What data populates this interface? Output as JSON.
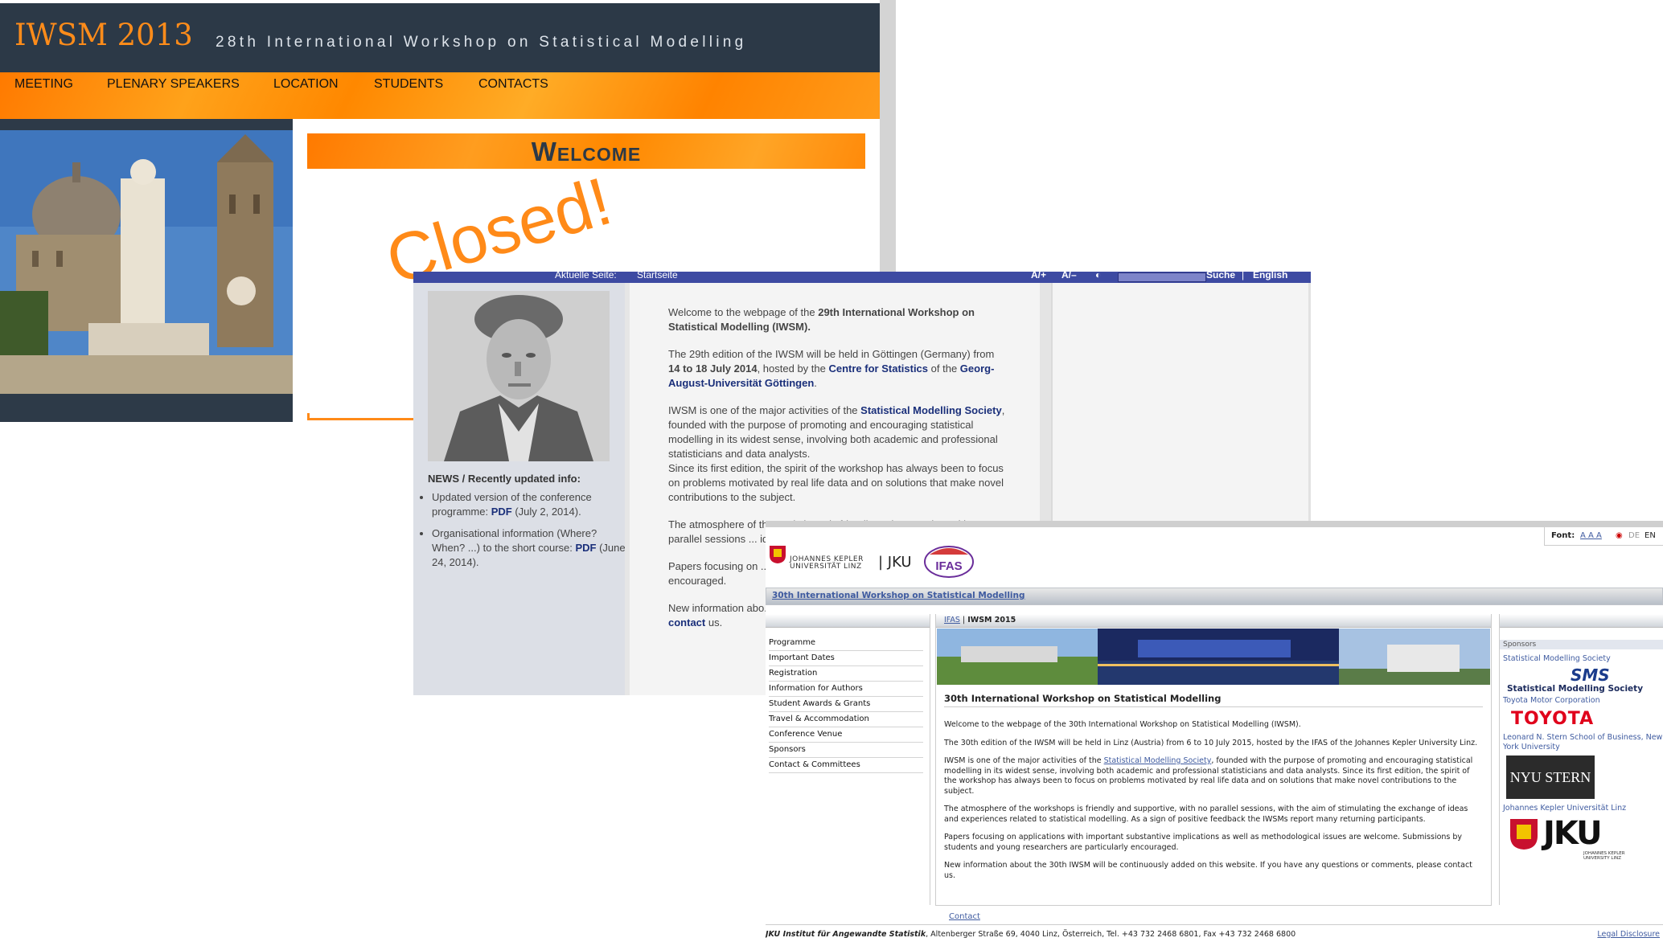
{
  "w1": {
    "logo": "IWSM 2013",
    "tagline": "28th International Workshop on Statistical Modelling",
    "nav": [
      "MEETING",
      "PLENARY SPEAKERS",
      "LOCATION",
      "STUDENTS",
      "CONTACTS"
    ],
    "welcome": "Welcome",
    "stamp": "Closed!",
    "colors": {
      "header": "#2c3947",
      "accent": "#ff8a18"
    }
  },
  "w2": {
    "topbar": {
      "breadcrumb_label": "Aktuelle Seite:",
      "breadcrumb_page": "Startseite",
      "font_plus": "A/+",
      "font_minus": "A/–",
      "search": "Suche",
      "lang": "English"
    },
    "news_title": "NEWS / Recently updated info:",
    "news": [
      {
        "pre": "Updated version of the conference programme: ",
        "link": "PDF",
        "post": " (July 2, 2014)."
      },
      {
        "pre": "Organisational information (Where? When? ...) to the short course: ",
        "link": "PDF",
        "post": " (June 24, 2014)."
      }
    ],
    "p1_pre": "Welcome to the webpage of the ",
    "p1_bold": "29th International Workshop on Statistical Modelling (IWSM).",
    "p2_a": "The 29th edition of the IWSM will be held in Göttingen (Germany) from ",
    "p2_bold": "14 to 18 July 2014",
    "p2_b": ", hosted by the ",
    "p2_link1": "Centre for Statistics",
    "p2_c": " of the ",
    "p2_link2": "Georg-August-Universität Göttingen",
    "p2_d": ".",
    "p3_a": "IWSM is one of the major activities of the ",
    "p3_link": "Statistical Modelling Society",
    "p3_b": ", founded with the purpose of promoting and encouraging statistical modelling in its widest sense, involving both academic and professional statisticians and data analysts.",
    "p3_c": "Since its first edition, the spirit of the workshop has always been to focus on problems motivated by real life data and on solutions that make novel contributions to the subject.",
    "p4": "The atmosphere of the workshops is friendly and supportive, with no parallel sessions ... ideas and experienc... positive feedback th...",
    "p5": "Papers focusing on ... implications as well ... Submissions by stu... encouraged.",
    "p6_a": "New information abo... on this website. If yo...",
    "p6_link": "contact",
    "p6_b": " us."
  },
  "w3": {
    "font_label": "Font:",
    "font_sizes": "A A A",
    "langs": [
      "DE",
      "EN"
    ],
    "jku_line1": "JOHANNES KEPLER",
    "jku_line2": "UNIVERSITÄT LINZ",
    "jku_short": "JKU",
    "ifas": "IFAS",
    "title_bar": "30th International Workshop on Statistical Modelling",
    "menu": [
      "Programme",
      "Important Dates",
      "Registration",
      "Information for Authors",
      "Student Awards & Grants",
      "Travel & Accommodation",
      "Conference Venue",
      "Sponsors",
      "Contact & Committees"
    ],
    "breadcrumb_link": "IFAS",
    "breadcrumb_sep": " | ",
    "breadcrumb_current": "IWSM 2015",
    "content_title": "30th International Workshop on Statistical Modelling",
    "paragraphs": [
      "Welcome to the webpage of the 30th International Workshop on Statistical Modelling (IWSM).",
      "The 30th edition of the IWSM will be held in Linz (Austria) from 6 to 10 July 2015, hosted by the IFAS of the Johannes Kepler University Linz.",
      "",
      "The atmosphere of the workshops is friendly and supportive, with no parallel sessions, with the aim of stimulating the exchange of ideas and experiences related to statistical modelling. As a sign of positive feedback the IWSMs report many returning participants.",
      "Papers focusing on applications with important substantive implications as well as methodological issues are welcome. Submissions by students and young researchers are particularly encouraged.",
      "New information about the 30th IWSM will be continuously added on this website. If you have any questions or comments, please contact us."
    ],
    "p3_a": "IWSM is one of the major activities of the ",
    "p3_link": "Statistical Modelling Society",
    "p3_b": ", founded with the purpose of promoting and encouraging statistical modelling in its widest sense, involving both academic and professional statisticians and data analysts. Since its first edition, the spirit of the workshop has always been to focus on problems motivated by real life data and on solutions that make novel contributions to the subject.",
    "sponsors_header": "Sponsors",
    "sponsors": [
      "Statistical Modelling Society",
      "Toyota Motor Corporation",
      "Leonard N. Stern School of Business, New York University",
      "Johannes Kepler Universität Linz"
    ],
    "sms_logo": "SMS",
    "sms_sub": "Statistical Modelling Society",
    "toyota_logo": "TOYOTA",
    "nyu_logo": "NYU STERN",
    "jku_logo": "JKU",
    "jku_logo_sub": "JOHANNES KEPLER UNIVERSITY LINZ",
    "contact": "Contact",
    "footer_bold": "JKU Institut für Angewandte Statistik",
    "footer_rest": ", Altenberger Straße 69, 4040 Linz, Österreich, Tel. +43 732 2468 6801, Fax +43 732 2468 6800",
    "legal": "Legal Disclosure"
  }
}
